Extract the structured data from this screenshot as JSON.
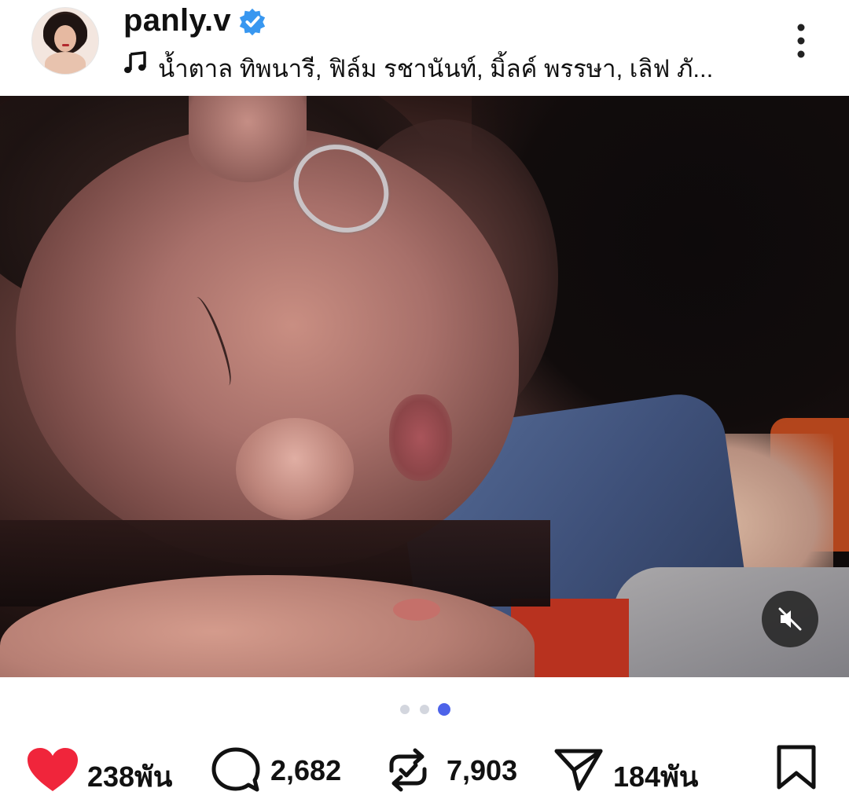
{
  "post": {
    "username": "panly.v",
    "verified": true,
    "music_label": "น้ำตาล ทิพนารี, ฟิล์ม รชานันท์, มิ้ลค์ พรรษา, เลิฟ ภั...",
    "media": {
      "description_icon": "mute-icon",
      "carousel": {
        "total": 3,
        "active_index": 2
      }
    },
    "actions": {
      "likes": "238พัน",
      "comments": "2,682",
      "reposts": "7,903",
      "shares": "184พัน"
    }
  },
  "colors": {
    "accent_blue": "#4d63e9",
    "verified_blue": "#3897f0",
    "like_red": "#f0253b",
    "text": "#111111"
  },
  "icons": {
    "more": "vertical-ellipsis-icon",
    "music": "music-note-icon",
    "like": "heart-icon",
    "comment": "comment-bubble-icon",
    "repost": "repost-icon",
    "share": "send-icon",
    "save": "bookmark-icon"
  }
}
